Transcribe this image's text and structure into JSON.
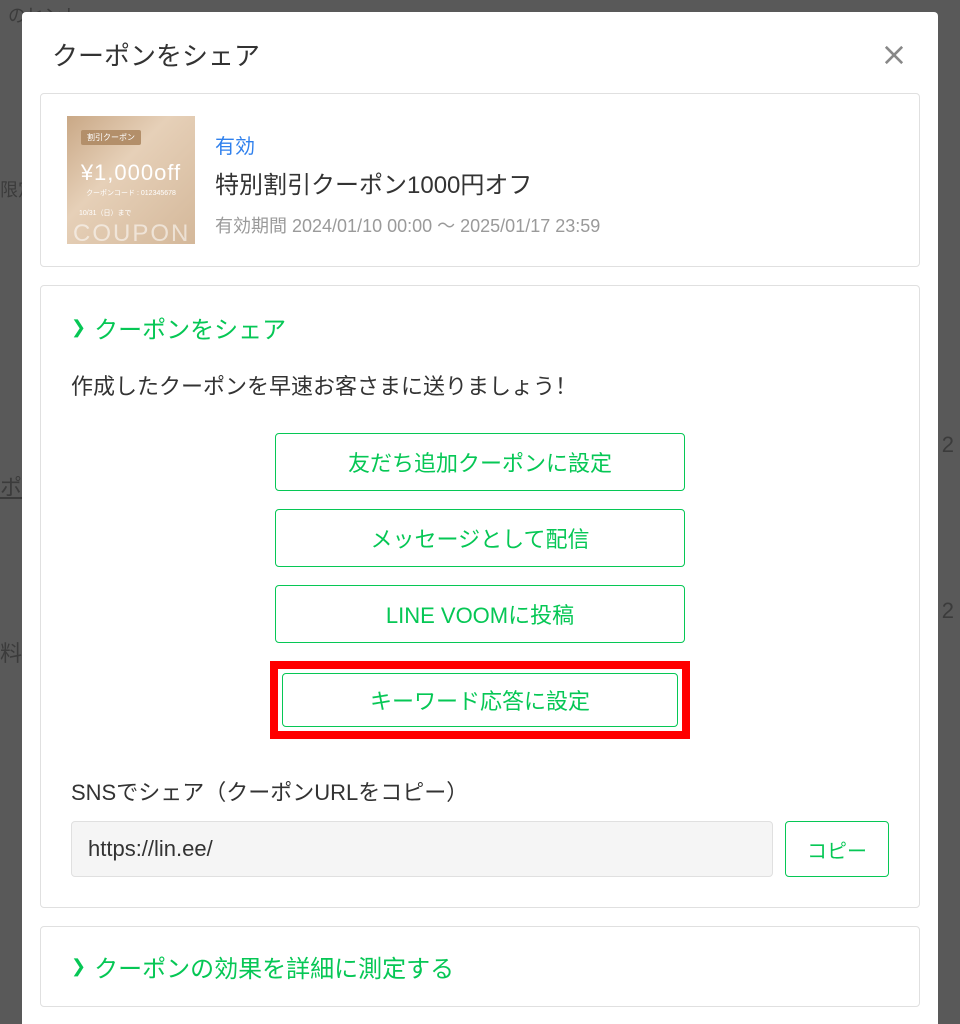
{
  "modal": {
    "title": "クーポンをシェア"
  },
  "coupon": {
    "status": "有効",
    "name": "特別割引クーポン1000円オフ",
    "period": "有効期間 2024/01/10 00:00 ～ 2025/01/17 23:59",
    "thumb": {
      "tag": "割引クーポン",
      "price": "¥1,000off",
      "code": "クーポンコード : 012345678",
      "subdate": "10/31（日）まで",
      "overlay": "COUPON"
    }
  },
  "share": {
    "section_title": "クーポンをシェア",
    "desc": "作成したクーポンを早速お客さまに送りましょう！",
    "buttons": {
      "add_friend": "友だち追加クーポンに設定",
      "send_message": "メッセージとして配信",
      "voom_post": "LINE VOOMに投稿",
      "keyword_reply": "キーワード応答に設定"
    },
    "sns_label": "SNSでシェア（クーポンURLをコピー）",
    "url_value": "https://lin.ee/",
    "copy_label": "コピー"
  },
  "measure": {
    "title": "クーポンの効果を詳細に測定する"
  },
  "bg": {
    "hint1": "のヒント",
    "hint2": "限定",
    "hint3": "ポ",
    "hint4": "料",
    "num1": "2",
    "num2": "2"
  }
}
